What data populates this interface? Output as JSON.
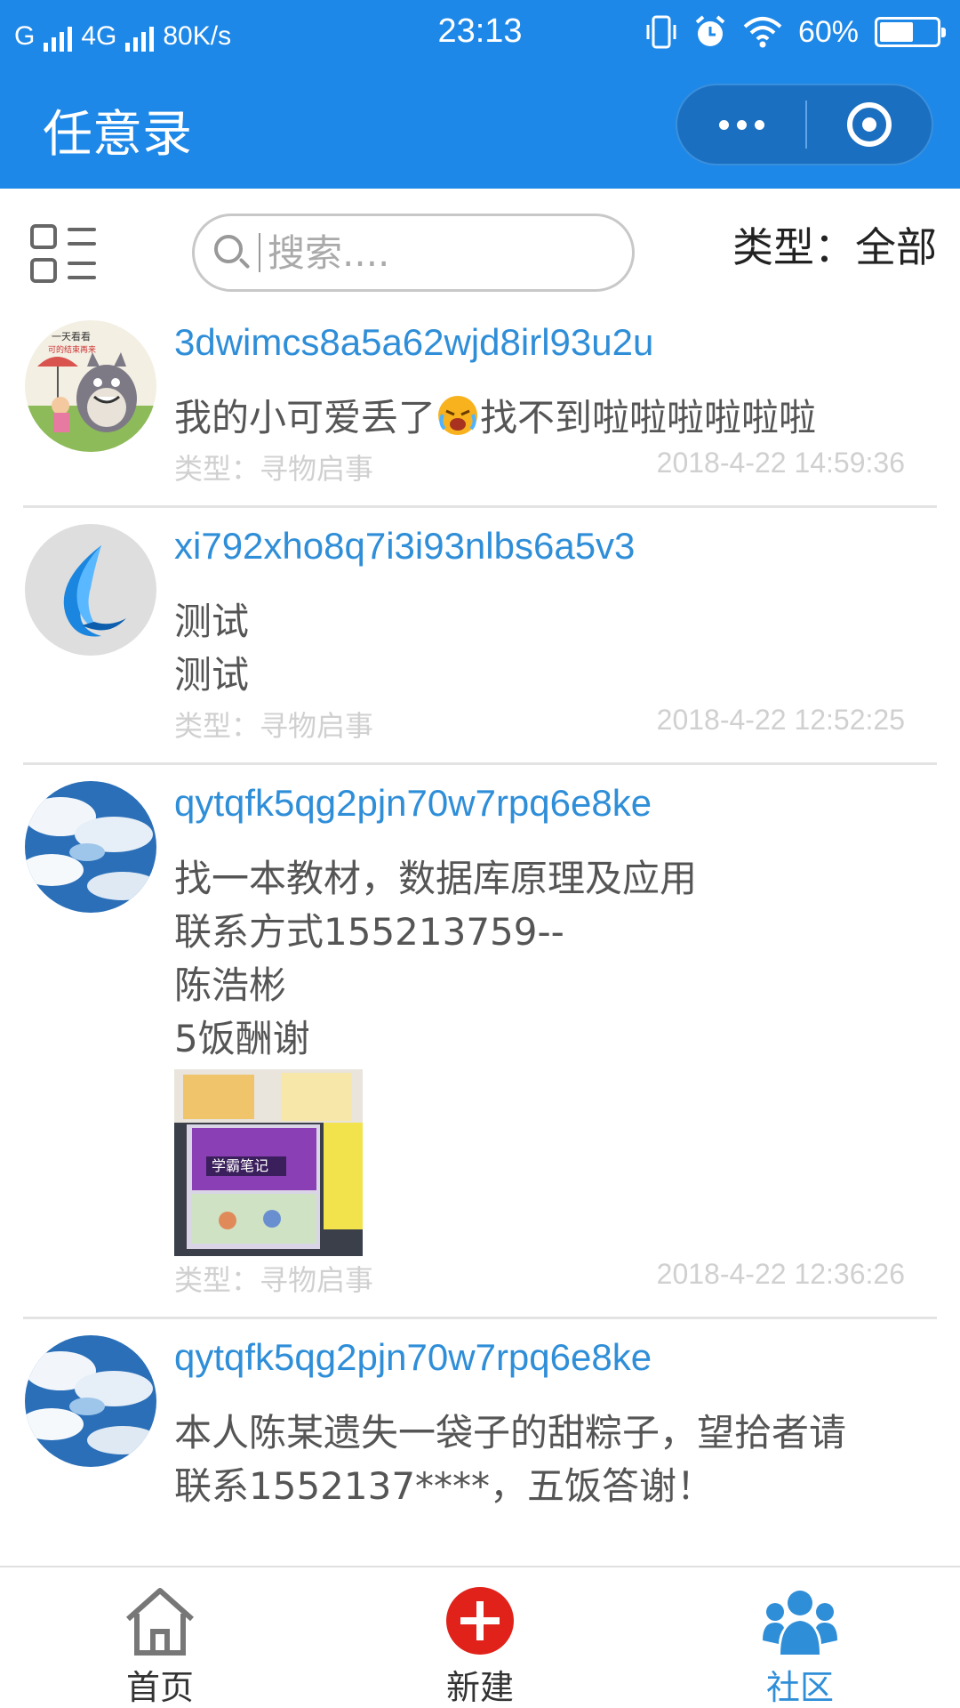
{
  "status_bar": {
    "carrier1": "G",
    "carrier2": "4G",
    "speed": "80K/s",
    "time": "23:13",
    "battery": "60%",
    "battery_level": 0.6,
    "icons": [
      "vibrate-icon",
      "alarm-icon",
      "wifi-icon",
      "battery-icon"
    ]
  },
  "header": {
    "title": "任意录",
    "background": "#1e88e8"
  },
  "toolbar": {
    "search_placeholder": "搜索....",
    "type_filter": "类型：全部"
  },
  "posts": [
    {
      "username": "3dwimcs8a5a62wjd8irl93u2u",
      "lines": [
        "我的小可爱丢了",
        "找不到啦啦啦啦啦啦"
      ],
      "type": "类型：寻物启事",
      "time": "2018-4-22 14:59:36"
    },
    {
      "username": "xi792xho8q7i3i93nlbs6a5v3",
      "lines": [
        "测试",
        "测试"
      ],
      "type": "类型：寻物启事",
      "time": "2018-4-22 12:52:25"
    },
    {
      "username": "qytqfk5qg2pjn70w7rpq6e8ke",
      "lines": [
        "找一本教材，数据库原理及应用",
        "联系方式155213759--",
        "陈浩彬",
        "5饭酬谢"
      ],
      "type": "类型：寻物启事",
      "time": "2018-4-22 12:36:26",
      "image_label": "学霸笔记"
    },
    {
      "username": "qytqfk5qg2pjn70w7rpq6e8ke",
      "lines": [
        "本人陈某遗失一袋子的甜粽子，望拾者请",
        "联系1552137****，五饭答谢！"
      ]
    }
  ],
  "tabbar": {
    "items": [
      {
        "label": "首页",
        "icon": "home-icon"
      },
      {
        "label": "新建",
        "icon": "plus-circle-icon"
      },
      {
        "label": "社区",
        "icon": "community-icon"
      }
    ],
    "active_index": 2,
    "active_color": "#2f8ed8",
    "new_color": "#e0221a"
  }
}
